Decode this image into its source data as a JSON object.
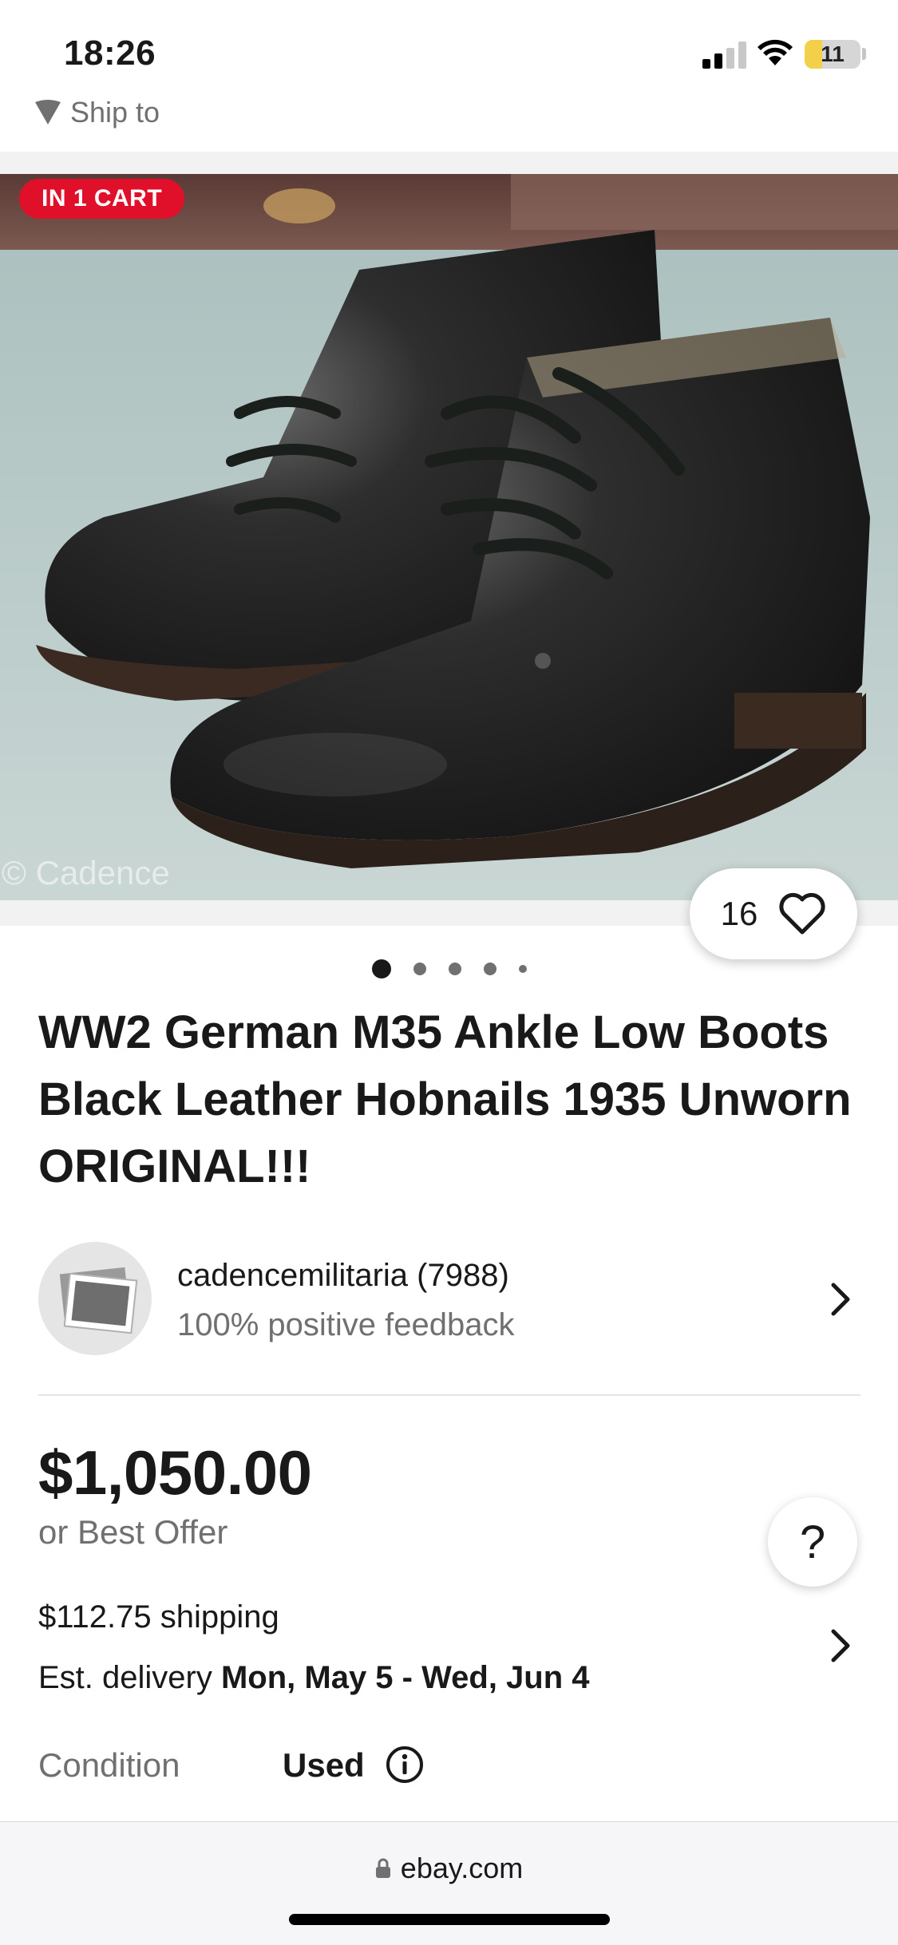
{
  "status_bar": {
    "time": "18:26",
    "battery": "11",
    "battery_level": 0.11
  },
  "header": {
    "ship_to_label": "Ship to",
    "icons": [
      "location-pin-icon"
    ]
  },
  "gallery": {
    "badge": "IN 1 CART",
    "watermark": "© Cadence",
    "watch_count": "16",
    "dot_count": 5,
    "active_dot": 0,
    "icons": [
      "heart-icon"
    ]
  },
  "listing": {
    "title": "WW2 German M35 Ankle Low Boots Black Leather Hobnails 1935 Unworn ORIGINAL!!!"
  },
  "seller": {
    "name": "cadencemilitaria (7988)",
    "feedback": "100% positive feedback",
    "icons": [
      "photo-placeholder-icon",
      "chevron-right-icon"
    ]
  },
  "price": {
    "amount": "$1,050.00",
    "best_offer": "or Best Offer",
    "help": "?"
  },
  "shipping": {
    "cost": "$112.75 shipping",
    "delivery_prefix": "Est. delivery ",
    "delivery_dates": "Mon, May 5 - Wed, Jun 4"
  },
  "condition": {
    "label": "Condition",
    "value": "Used",
    "icons": [
      "info-icon"
    ]
  },
  "browser": {
    "url": "ebay.com",
    "icons": [
      "lock-icon"
    ]
  },
  "colors": {
    "badge_red": "#e0102a",
    "text": "#191919",
    "muted": "#707070",
    "battery_yellow": "#f2d04a"
  }
}
